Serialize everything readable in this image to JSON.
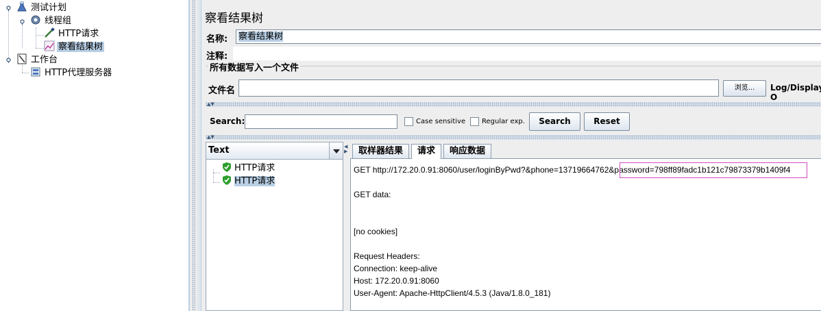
{
  "tree": {
    "test_plan": "测试计划",
    "thread_group": "线程组",
    "http_request": "HTTP请求",
    "result_tree": "察看结果树",
    "workbench": "工作台",
    "proxy_server": "HTTP代理服务器"
  },
  "panel": {
    "title": "察看结果树",
    "name_label": "名称:",
    "name_value": "察看结果树",
    "comment_label": "注释:",
    "comment_value": "",
    "file_group_title": "所有数据写入一个文件",
    "filename_label": "文件名",
    "filename_value": "",
    "browse_button": "浏览...",
    "log_display_label": "Log/Display O"
  },
  "search": {
    "label": "Search:",
    "value": "",
    "case_sensitive_label": "Case sensitive",
    "regex_label": "Regular exp.",
    "search_button": "Search",
    "reset_button": "Reset"
  },
  "results": {
    "renderer_value": "Text",
    "items": [
      "HTTP请求",
      "HTTP请求"
    ],
    "tabs": [
      "取样器结果",
      "请求",
      "响应数据"
    ],
    "active_tab": "请求",
    "request_lines": [
      "GET http://172.20.0.91:8060/user/loginByPwd?&phone=13719664762&password=798ff89fadc1b121c79873379b1409f4",
      "GET data:",
      "[no cookies]",
      "Request Headers:",
      "Connection: keep-alive",
      "Host: 172.20.0.91:8060",
      "User-Agent: Apache-HttpClient/4.5.3 (Java/1.8.0_181)"
    ]
  },
  "colors": {
    "selection": "#b8cfe5",
    "highlight_border": "#d24bc0",
    "success_icon": "#2e9e2e"
  }
}
